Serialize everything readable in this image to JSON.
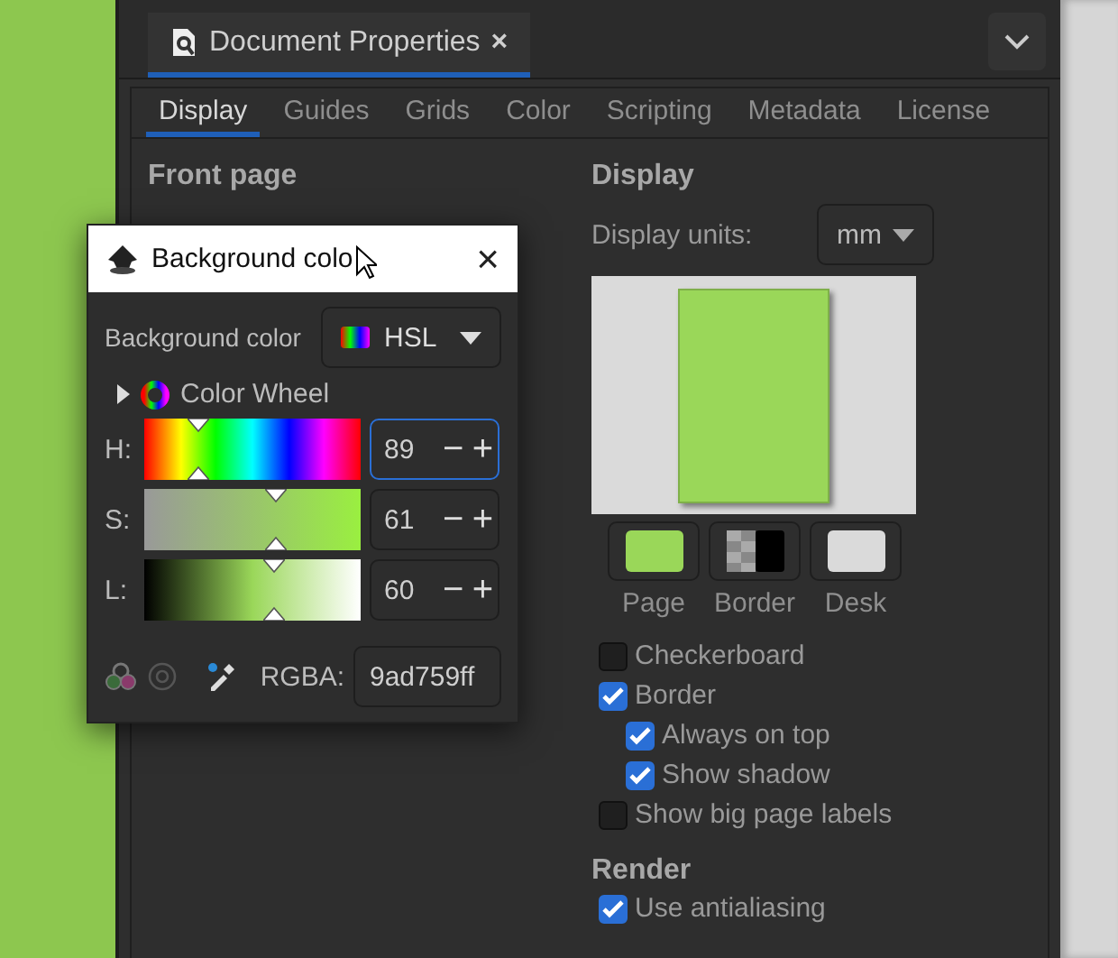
{
  "dock_tab": {
    "title": "Document Properties",
    "close": "×",
    "selected": true
  },
  "tabs": [
    {
      "label": "Display",
      "selected": true
    },
    {
      "label": "Guides",
      "selected": false
    },
    {
      "label": "Grids",
      "selected": false
    },
    {
      "label": "Color",
      "selected": false
    },
    {
      "label": "Scripting",
      "selected": false
    },
    {
      "label": "Metadata",
      "selected": false
    },
    {
      "label": "License",
      "selected": false
    }
  ],
  "front_page": {
    "heading": "Front page"
  },
  "display": {
    "heading": "Display",
    "units_label": "Display units:",
    "units_value": "mm",
    "swatches": [
      {
        "label": "Page",
        "kind": "solid",
        "color": "#9ad759"
      },
      {
        "label": "Border",
        "kind": "checker",
        "color": "#000000"
      },
      {
        "label": "Desk",
        "kind": "solid",
        "color": "#dadada"
      }
    ],
    "options": [
      {
        "label": "Checkerboard",
        "checked": false
      },
      {
        "label": "Border",
        "checked": true,
        "children": [
          {
            "label": "Always on top",
            "checked": true
          },
          {
            "label": "Show shadow",
            "checked": true
          }
        ]
      },
      {
        "label": "Show big page labels",
        "checked": false
      }
    ]
  },
  "render": {
    "heading": "Render",
    "options": [
      {
        "label": "Use antialiasing",
        "checked": true
      }
    ]
  },
  "dialog": {
    "title": "Background colo",
    "close": "×",
    "label": "Background color",
    "mode": "HSL",
    "wheel_label": "Color Wheel",
    "expanded": false,
    "channels": [
      {
        "name": "H:",
        "kind": "hue",
        "level": 0.25,
        "value": "89",
        "focused": true
      },
      {
        "name": "S:",
        "kind": "saturation",
        "level": 0.61,
        "value": "61",
        "focused": false
      },
      {
        "name": "L:",
        "kind": "lightness",
        "level": 0.6,
        "value": "60",
        "focused": false
      }
    ],
    "minus": "−",
    "plus": "+",
    "rgba_label": "RGBA:",
    "rgba": "9ad759ff"
  }
}
